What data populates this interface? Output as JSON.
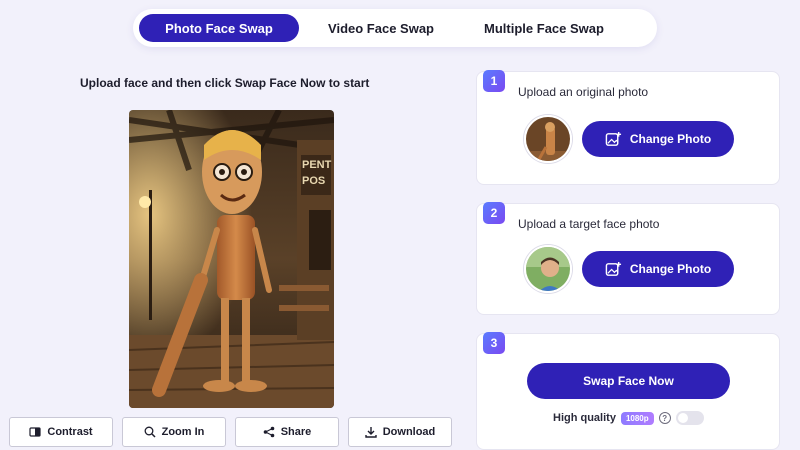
{
  "tabs": [
    {
      "label": "Photo Face Swap",
      "active": true
    },
    {
      "label": "Video Face Swap",
      "active": false
    },
    {
      "label": "Multiple Face Swap",
      "active": false
    }
  ],
  "left": {
    "instructions": "Upload face and then click Swap Face Now to start",
    "preview_sign_text": [
      "PENT",
      "POS"
    ],
    "toolbar": [
      {
        "label": "Contrast",
        "icon": "contrast-icon"
      },
      {
        "label": "Zoom In",
        "icon": "zoom-in-icon"
      },
      {
        "label": "Share",
        "icon": "share-icon"
      },
      {
        "label": "Download",
        "icon": "download-icon"
      }
    ]
  },
  "steps": [
    {
      "number": "1",
      "title": "Upload an original photo",
      "button": "Change Photo"
    },
    {
      "number": "2",
      "title": "Upload a target face photo",
      "button": "Change Photo"
    },
    {
      "number": "3",
      "button": "Swap Face Now",
      "quality_label": "High quality",
      "quality_badge": "1080p",
      "help": "?"
    }
  ],
  "colors": {
    "accent": "#2f21b6",
    "background": "#f2f1fb",
    "badge_gradient_start": "#5a7cff",
    "badge_gradient_end": "#7a49f1"
  }
}
